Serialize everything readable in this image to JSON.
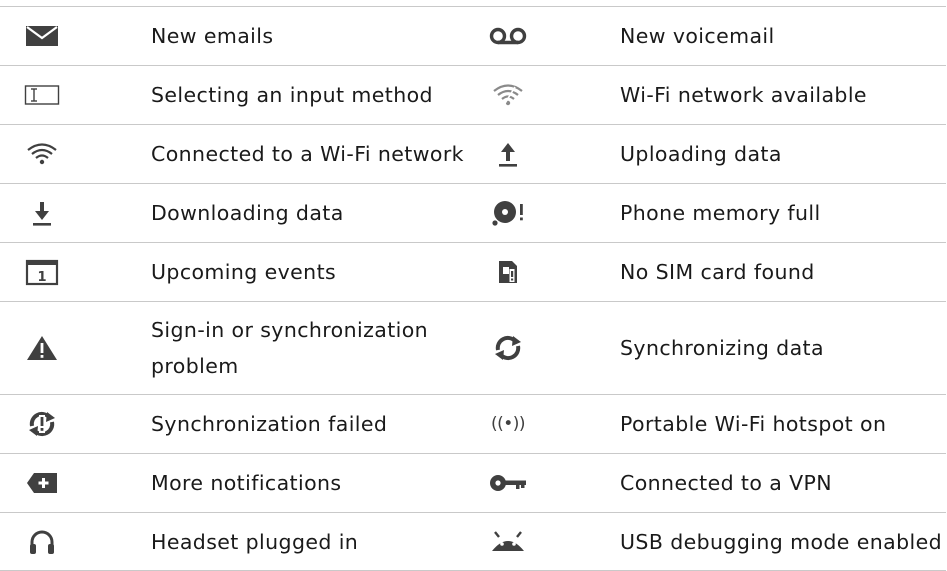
{
  "colors": {
    "icon": "#404040",
    "rule": "#c9c9c9",
    "text": "#1a1a1a"
  },
  "rows": [
    {
      "left": {
        "icon": "email-icon",
        "label": "New emails"
      },
      "right": {
        "icon": "voicemail-icon",
        "label": "New voicemail"
      }
    },
    {
      "left": {
        "icon": "input-method-icon",
        "label": "Selecting an input method"
      },
      "right": {
        "icon": "wifi-available-icon",
        "label": "Wi-Fi network available"
      }
    },
    {
      "left": {
        "icon": "wifi-connected-icon",
        "label": "Connected to a Wi-Fi network"
      },
      "right": {
        "icon": "upload-icon",
        "label": "Uploading data"
      }
    },
    {
      "left": {
        "icon": "download-icon",
        "label": "Downloading data"
      },
      "right": {
        "icon": "memory-full-icon",
        "label": "Phone memory full"
      }
    },
    {
      "left": {
        "icon": "calendar-icon",
        "label": "Upcoming events",
        "glyph": "1"
      },
      "right": {
        "icon": "no-sim-icon",
        "label": "No SIM card found"
      }
    },
    {
      "left": {
        "icon": "warning-icon",
        "label": "Sign-in or synchronization problem"
      },
      "right": {
        "icon": "sync-icon",
        "label": "Synchronizing data"
      }
    },
    {
      "left": {
        "icon": "sync-failed-icon",
        "label": "Synchronization failed"
      },
      "right": {
        "icon": "hotspot-icon",
        "label": "Portable Wi-Fi hotspot on",
        "glyph": "((•))"
      }
    },
    {
      "left": {
        "icon": "more-notifications-icon",
        "label": "More notifications"
      },
      "right": {
        "icon": "vpn-key-icon",
        "label": "Connected to a VPN"
      }
    },
    {
      "left": {
        "icon": "headset-icon",
        "label": "Headset plugged in"
      },
      "right": {
        "icon": "android-debug-icon",
        "label": "USB debugging mode enabled"
      }
    }
  ]
}
